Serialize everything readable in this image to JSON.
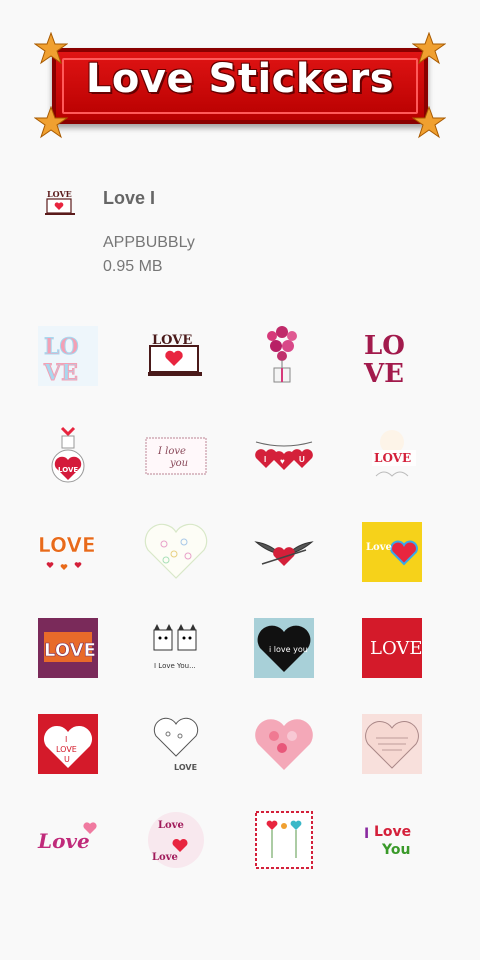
{
  "banner": {
    "title": "Love Stickers"
  },
  "pack": {
    "name": "Love I",
    "author": "APPBUBBLy",
    "size": "0.95 MB",
    "icon": "love-laptop-icon",
    "icon_text": "LOVE"
  },
  "stickers": [
    {
      "id": "love-letters-doodle",
      "text": "LOVE"
    },
    {
      "id": "love-laptop-heart",
      "text": "LOVE"
    },
    {
      "id": "heart-balloons-gift",
      "text": ""
    },
    {
      "id": "love-red-letters",
      "text": "LOVE"
    },
    {
      "id": "love-potion-bottle",
      "text": "LOVE"
    },
    {
      "id": "i-love-you-note",
      "text": "I love you"
    },
    {
      "id": "i-love-u-hanging-hearts",
      "text": "I ♥ U"
    },
    {
      "id": "love-ice-cream",
      "text": "LOVE"
    },
    {
      "id": "love-orange-word",
      "text": "LOVE"
    },
    {
      "id": "heart-pattern-doodle",
      "text": ""
    },
    {
      "id": "winged-heart",
      "text": ""
    },
    {
      "id": "love-rainbow-heart",
      "text": "Love"
    },
    {
      "id": "love-purple-patch",
      "text": "LOVE"
    },
    {
      "id": "cats-i-love-you",
      "text": "I Love You..."
    },
    {
      "id": "i-love-you-black-heart",
      "text": "i love you"
    },
    {
      "id": "love-red-square",
      "text": "LOVE"
    },
    {
      "id": "i-love-u-red-card",
      "text": "I LOVE U"
    },
    {
      "id": "love-sketch-hearts",
      "text": "LOVE"
    },
    {
      "id": "pink-hearts-collage",
      "text": ""
    },
    {
      "id": "handwritten-heart",
      "text": ""
    },
    {
      "id": "love-pink-word",
      "text": "Love"
    },
    {
      "id": "love-circle-words",
      "text": "Love"
    },
    {
      "id": "heart-flowers-stamp",
      "text": ""
    },
    {
      "id": "i-love-you-colorful",
      "text": "I Love You"
    }
  ],
  "colors": {
    "accent": "#d40000",
    "background": "#f9f9f9"
  }
}
